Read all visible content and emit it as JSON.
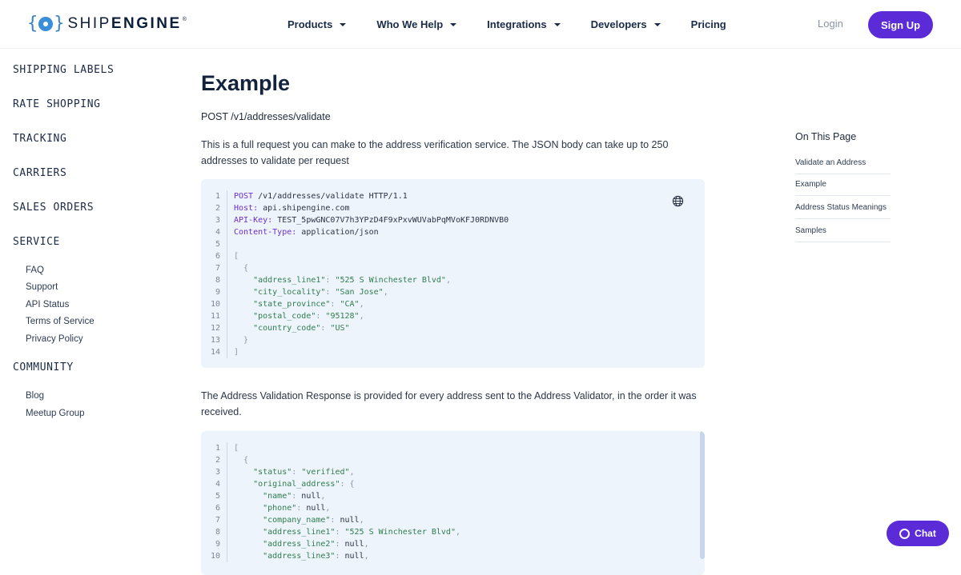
{
  "header": {
    "logo_text_light": "SHIP",
    "logo_text_bold": "ENGINE",
    "logo_reg": "®",
    "nav": [
      {
        "label": "Products",
        "has_caret": true
      },
      {
        "label": "Who We Help",
        "has_caret": true
      },
      {
        "label": "Integrations",
        "has_caret": true
      },
      {
        "label": "Developers",
        "has_caret": true
      },
      {
        "label": "Pricing",
        "has_caret": false
      }
    ],
    "login_label": "Login",
    "signup_label": "Sign Up",
    "brand_color": "#5b2bd8"
  },
  "sidebar": {
    "sections": [
      {
        "label": "SHIPPING LABELS"
      },
      {
        "label": "RATE SHOPPING"
      },
      {
        "label": "TRACKING"
      },
      {
        "label": "CARRIERS"
      },
      {
        "label": "SALES ORDERS"
      },
      {
        "label": "SERVICE",
        "links": [
          "FAQ",
          "Support",
          "API Status",
          "Terms of Service",
          "Privacy Policy"
        ]
      },
      {
        "label": "COMMUNITY",
        "links": [
          "Blog",
          "Meetup Group"
        ]
      }
    ]
  },
  "main": {
    "title": "Example",
    "endpoint": "POST /v1/addresses/validate",
    "intro": "This is a full request you can make to the address verification service. The JSON body can take up to 250 addresses to validate per request",
    "request_code": [
      "POST /v1/addresses/validate HTTP/1.1",
      "Host: api.shipengine.com",
      "API-Key: TEST_5pwGNC07V7h3YPzD4F9xPxvWUVabPqMVoKFJ0RDNVB0",
      "Content-Type: application/json",
      "",
      "[",
      "  {",
      "    \"address_line1\": \"525 S Winchester Blvd\",",
      "    \"city_locality\": \"San Jose\",",
      "    \"state_province\": \"CA\",",
      "    \"postal_code\": \"95128\",",
      "    \"country_code\": \"US\"",
      "  }",
      "]"
    ],
    "response_intro": "The Address Validation Response is provided for every address sent to the Address Validator, in the order it was received.",
    "response_code": [
      "[",
      "  {",
      "    \"status\": \"verified\",",
      "    \"original_address\": {",
      "      \"name\": null,",
      "      \"phone\": null,",
      "      \"company_name\": null,",
      "      \"address_line1\": \"525 S Winchester Blvd\",",
      "      \"address_line2\": null,",
      "      \"address_line3\": null,"
    ]
  },
  "toc": {
    "title": "On This Page",
    "items": [
      "Validate an Address",
      "Example",
      "Address Status Meanings",
      "Samples"
    ]
  },
  "chat": {
    "label": "Chat"
  },
  "icons": {
    "globe": "globe-icon",
    "chat": "chat-bubble-icon",
    "logo": "gear-icon"
  }
}
